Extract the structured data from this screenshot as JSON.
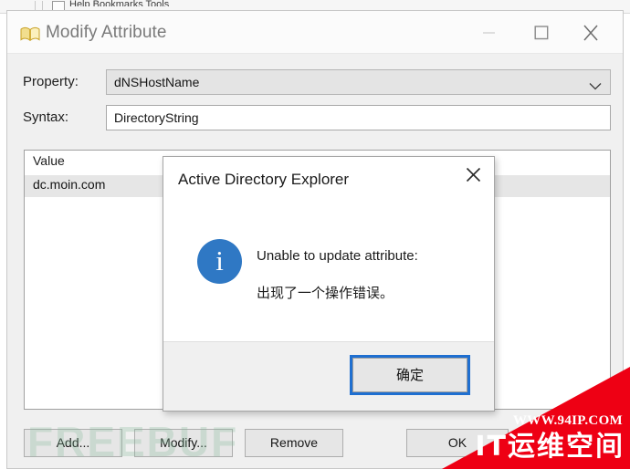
{
  "background_app": {
    "visible_fragment": "Help  Bookmarks      Tools",
    "icon": "document-icon"
  },
  "window": {
    "title": "Modify Attribute",
    "icon": "open-book-icon",
    "controls": {
      "minimize": "minimize-icon",
      "maximize": "maximize-icon",
      "close": "close-icon"
    },
    "fields": [
      {
        "label": "Property:",
        "value": "dNSHostName",
        "type": "combobox"
      },
      {
        "label": "Syntax:",
        "value": "DirectoryString",
        "type": "textbox"
      }
    ],
    "value_list": {
      "column_header": "Value",
      "rows": [
        "dc.moin.com"
      ]
    },
    "buttons": {
      "add": "Add...",
      "modify": "Modify...",
      "remove": "Remove",
      "ok": "OK"
    }
  },
  "dialog": {
    "title": "Active Directory Explorer",
    "close_icon": "close-icon",
    "icon": "info-icon",
    "icon_glyph": "i",
    "icon_color": "#2f78c4",
    "message_line1": "Unable to update attribute:",
    "message_line2": "出现了一个操作错误。",
    "ok_button": "确定",
    "focus_color": "#1f6fd0"
  },
  "watermarks": {
    "freebuf": "FREEBUF",
    "corner_url": "WWW.94IP.COM",
    "corner_text": "IT运维空间",
    "corner_color": "#ee0014"
  }
}
